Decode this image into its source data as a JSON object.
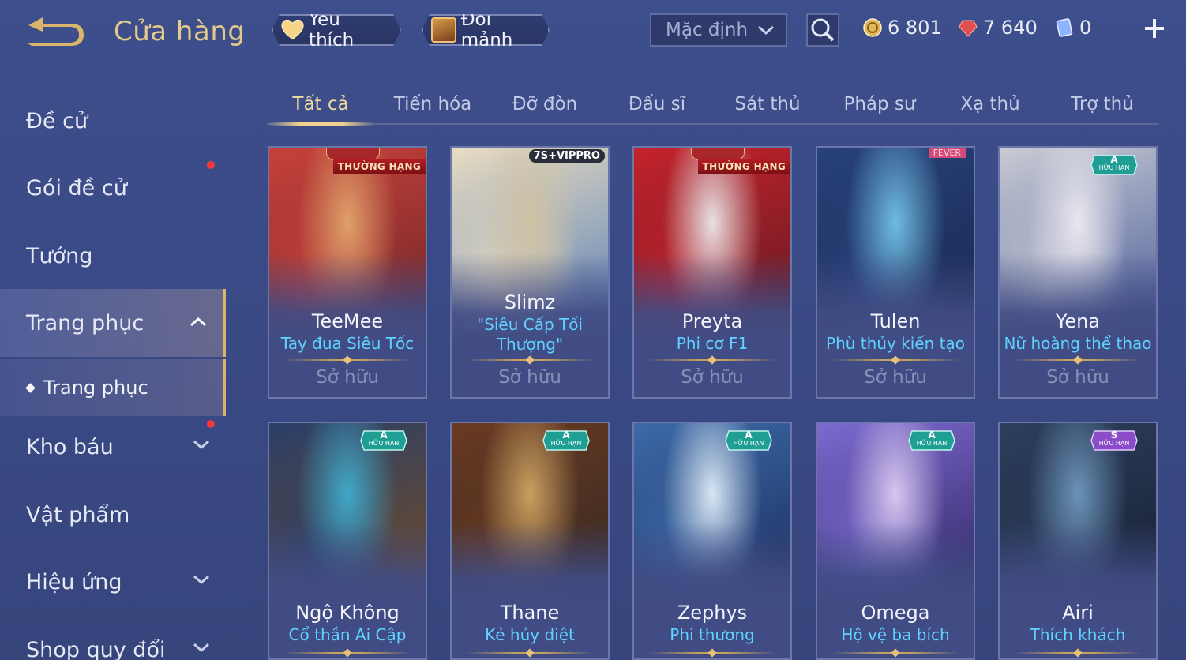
{
  "header": {
    "title": "Cửa hàng",
    "favorite_label": "Yêu thích",
    "shards_label": "Đổi mảnh",
    "sort_value": "Mặc định"
  },
  "currencies": [
    {
      "name": "gold-coin",
      "value": "6 801",
      "color": "#e0b75a"
    },
    {
      "name": "ruby",
      "value": "7 640",
      "color": "#e0504f"
    },
    {
      "name": "gem",
      "value": "0",
      "color": "#8fb4ff"
    }
  ],
  "sidebar": {
    "items": [
      {
        "label": "Đề cử"
      },
      {
        "label": "Gói đề cử"
      },
      {
        "label": "Tướng"
      },
      {
        "label": "Trang phục"
      },
      {
        "label": "Trang phục"
      },
      {
        "label": "Kho báu"
      },
      {
        "label": "Vật phẩm"
      },
      {
        "label": "Hiệu ứng"
      },
      {
        "label": "Shop quy đổi"
      }
    ]
  },
  "tabs": [
    {
      "label": "Tất cả"
    },
    {
      "label": "Tiến hóa"
    },
    {
      "label": "Đỡ đòn"
    },
    {
      "label": "Đấu sĩ"
    },
    {
      "label": "Sát thủ"
    },
    {
      "label": "Pháp sư"
    },
    {
      "label": "Xạ thủ"
    },
    {
      "label": "Trợ thủ"
    }
  ],
  "cards": [
    {
      "hero": "TeeMee",
      "skin": "Tay đua Siêu Tốc",
      "status": "Sở hữu",
      "tag": "THƯỜNG HẠNG",
      "tag_type": "ribbon",
      "art": [
        "#c8413b",
        "#7a2a2a",
        "#e0a06a"
      ]
    },
    {
      "hero": "Slimz",
      "skin": "\"Siêu Cấp Tối Thượng\"",
      "status": "Sở hữu",
      "tag": "7S+VIPPRO",
      "tag_type": "vip",
      "art": [
        "#e9dcc2",
        "#6b8bb8",
        "#cfc2a4"
      ]
    },
    {
      "hero": "Preyta",
      "skin": "Phi cơ F1",
      "status": "Sở hữu",
      "tag": "THƯỜNG HẠNG",
      "tag_type": "ribbon",
      "art": [
        "#c5232c",
        "#6d1a22",
        "#e8e1e3"
      ]
    },
    {
      "hero": "Tulen",
      "skin": "Phù thủy kiến tạo",
      "status": "Sở hữu",
      "tag": "FEVER",
      "tag_type": "fever",
      "art": [
        "#27427a",
        "#1a2a55",
        "#6fbce0"
      ]
    },
    {
      "hero": "Yena",
      "skin": "Nữ hoàng thể thao",
      "status": "Sở hữu",
      "tag": "A",
      "tag_sub": "HỮU HẠN",
      "tag_type": "rank",
      "art": [
        "#c9cbd4",
        "#5a6aa0",
        "#e9e6ee"
      ]
    },
    {
      "hero": "Ngộ Không",
      "skin": "Cổ thần Ai Cập",
      "status": "",
      "tag": "A",
      "tag_sub": "HỮU HẠN",
      "tag_type": "rank",
      "art": [
        "#2a3f6a",
        "#6a4a2a",
        "#3fa8c8"
      ]
    },
    {
      "hero": "Thane",
      "skin": "Kẻ hủy diệt",
      "status": "",
      "tag": "A",
      "tag_sub": "HỮU HẠN",
      "tag_type": "rank",
      "art": [
        "#6a3a22",
        "#3a2a22",
        "#c8a060"
      ]
    },
    {
      "hero": "Zephys",
      "skin": "Phi thương",
      "status": "",
      "tag": "A",
      "tag_sub": "HỮU HẠN",
      "tag_type": "rank",
      "art": [
        "#3d6aa8",
        "#1e3566",
        "#d7e6f3"
      ]
    },
    {
      "hero": "Omega",
      "skin": "Hộ vệ ba bích",
      "status": "",
      "tag": "A",
      "tag_sub": "HỮU HẠN",
      "tag_type": "rank",
      "art": [
        "#7c6ad0",
        "#3a2e70",
        "#d6c6f0"
      ]
    },
    {
      "hero": "Airi",
      "skin": "Thích khách",
      "status": "",
      "tag": "S",
      "tag_sub": "HỮU HẠN",
      "tag_type": "rank-s",
      "art": [
        "#2d3f5e",
        "#1a2336",
        "#6b93b8"
      ]
    }
  ]
}
